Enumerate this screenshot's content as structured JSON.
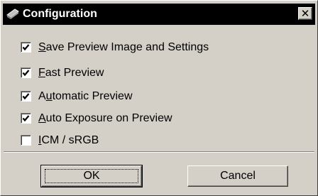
{
  "window": {
    "title": "Configuration"
  },
  "options": [
    {
      "label": "Save Preview Image and Settings",
      "mnemonic": "S",
      "checked": true
    },
    {
      "label": "Fast Preview",
      "mnemonic": "F",
      "checked": true
    },
    {
      "label": "Automatic Preview",
      "mnemonic": "u",
      "checked": true
    },
    {
      "label": "Auto Exposure on Preview",
      "mnemonic": "A",
      "checked": true
    },
    {
      "label": "ICM / sRGB",
      "mnemonic": "I",
      "checked": false
    }
  ],
  "buttons": {
    "ok_label": "OK",
    "cancel_label": "Cancel"
  },
  "icons": {
    "app": "scanner-icon",
    "close": "close-icon",
    "check": "checkmark-icon"
  }
}
